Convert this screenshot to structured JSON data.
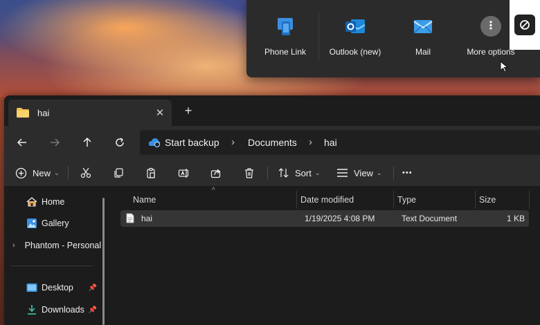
{
  "share_flyout": {
    "apps": [
      {
        "label": "Phone Link",
        "icon": "phone-link-icon"
      },
      {
        "label": "Outlook (new)",
        "icon": "outlook-icon"
      },
      {
        "label": "Mail",
        "icon": "mail-icon"
      },
      {
        "label": "More options",
        "icon": "more-options-icon"
      }
    ]
  },
  "tab": {
    "title": "hai",
    "close_glyph": "✕",
    "new_tab_glyph": "+"
  },
  "address": {
    "crumbs": [
      "Start backup",
      "Documents",
      "hai"
    ]
  },
  "commands": {
    "new_label": "New",
    "sort_label": "Sort",
    "view_label": "View",
    "more_glyph": "•••"
  },
  "sidebar": {
    "items": [
      {
        "label": "Home",
        "icon": "home-icon"
      },
      {
        "label": "Gallery",
        "icon": "gallery-icon"
      },
      {
        "label": "Phantom - Personal",
        "icon": "onedrive-cloud-icon"
      },
      {
        "label": "Desktop",
        "icon": "desktop-folder-icon",
        "pinned": true
      },
      {
        "label": "Downloads",
        "icon": "downloads-icon",
        "pinned": true
      }
    ]
  },
  "file_list": {
    "columns": [
      "Name",
      "Date modified",
      "Type",
      "Size"
    ],
    "rows": [
      {
        "name": "hai",
        "date_modified": "1/19/2025 4:08 PM",
        "type": "Text Document",
        "size": "1 KB"
      }
    ]
  },
  "colors": {
    "window_bg": "#1c1c1c",
    "toolbar_bg": "#2c2c2c",
    "accent_blue": "#3b8fe0",
    "folder_yellow": "#f2c14e"
  }
}
